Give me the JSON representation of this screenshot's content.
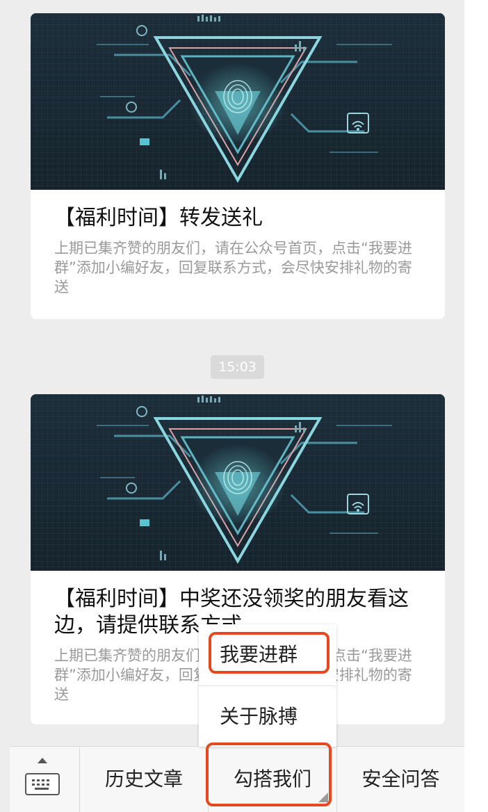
{
  "articles": [
    {
      "title": "【福利时间】转发送礼",
      "description": "上期已集齐赞的朋友们，请在公众号首页，点击“我要进群”添加小编好友，回复联系方式，会尽快安排礼物的寄送"
    },
    {
      "title": "【福利时间】中奖还没领奖的朋友看这边，请提供联系方式",
      "description": "上期已集齐赞的朋友们，请在公众号首页，点击“我要进群”添加小编好友，回复联系方式，会尽快安排礼物的寄送"
    }
  ],
  "timestamp": "15:03",
  "bottom_menu": {
    "keyboard_icon": "keyboard-icon",
    "items": [
      {
        "label": "历史文章"
      },
      {
        "label": "勾搭我们"
      },
      {
        "label": "安全问答"
      }
    ]
  },
  "popup_menu": {
    "items": [
      {
        "label": "我要进群"
      },
      {
        "label": "关于脉搏"
      }
    ]
  },
  "colors": {
    "highlight": "#e8481f",
    "background": "#ededed",
    "cover": "#1b2a35"
  }
}
